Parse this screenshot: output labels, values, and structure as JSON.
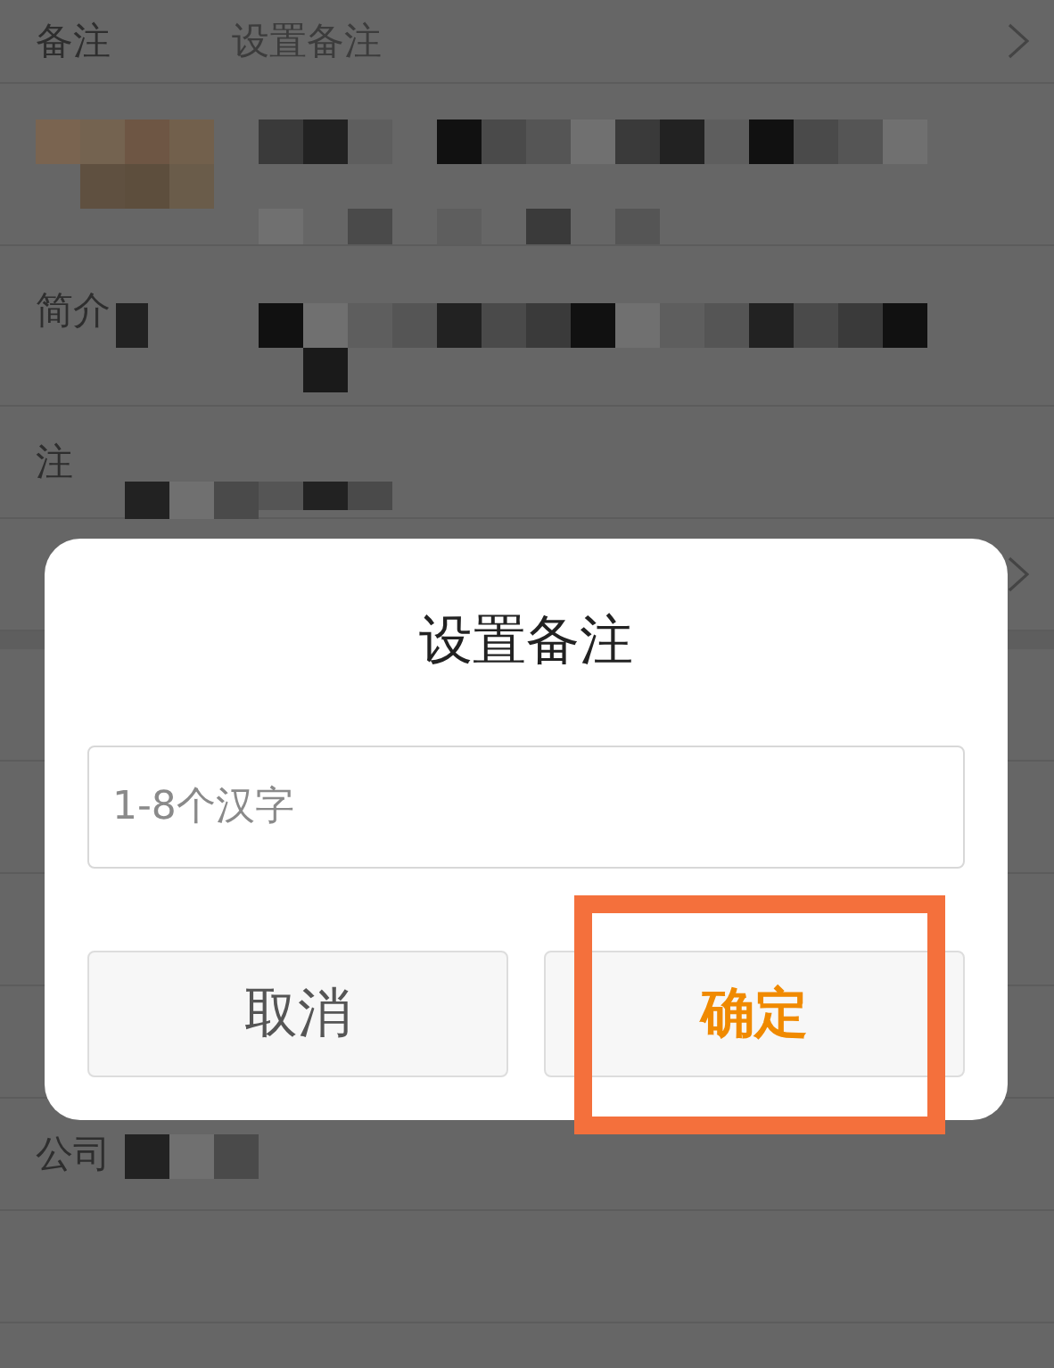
{
  "list": [
    {
      "kind": "compact",
      "label": "备注",
      "value": "设置备注",
      "chevron": true,
      "redacted": false
    },
    {
      "kind": "avatar",
      "redacted": true,
      "chevron": false
    },
    {
      "kind": "double",
      "label": "简介",
      "redacted": true,
      "chevron": false
    },
    {
      "kind": "single",
      "label": "注",
      "redacted": true,
      "chevron": false
    },
    {
      "kind": "single",
      "chevron": true,
      "redacted": false
    },
    {
      "kind": "gap"
    },
    {
      "kind": "single",
      "chevron": false,
      "redacted": false
    },
    {
      "kind": "single",
      "chevron": false,
      "redacted": false
    },
    {
      "kind": "single",
      "chevron": false,
      "redacted": false
    },
    {
      "kind": "single",
      "chevron": false,
      "redacted": false
    },
    {
      "kind": "single",
      "label": "公司",
      "redacted": true,
      "chevron": false
    },
    {
      "kind": "single",
      "chevron": false,
      "redacted": false
    }
  ],
  "dialog": {
    "title": "设置备注",
    "input": {
      "placeholder": "1-8个汉字"
    },
    "buttons": [
      {
        "label": "取消",
        "kind": "cancel",
        "highlighted": false
      },
      {
        "label": "确定",
        "kind": "confirm",
        "highlighted": true
      }
    ]
  }
}
